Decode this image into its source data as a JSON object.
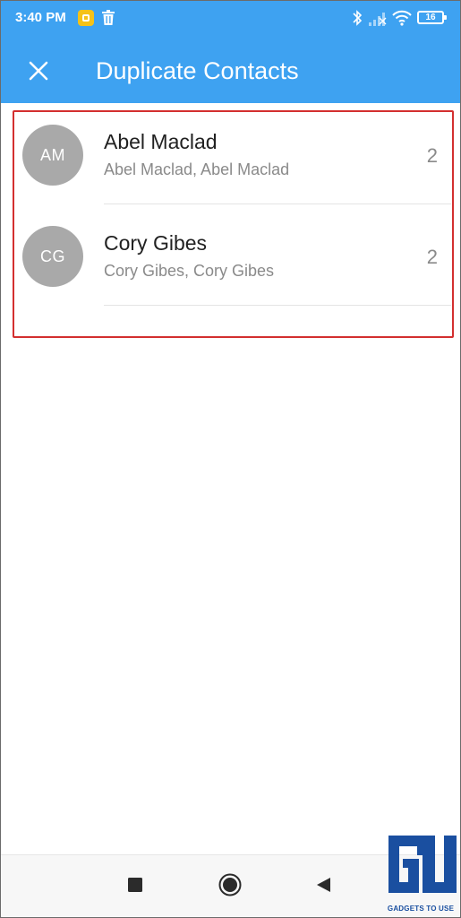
{
  "colors": {
    "accent": "#3ea2f1",
    "avatar": "#a9a9a9",
    "highlight": "#d32f2f",
    "watermark": "#1a4fa0"
  },
  "status_bar": {
    "time": "3:40 PM",
    "battery": "16",
    "icons": [
      "notification-icon",
      "trash-icon",
      "bluetooth-icon",
      "signal-icon",
      "wifi-icon",
      "battery-icon"
    ]
  },
  "app_bar": {
    "title": "Duplicate Contacts",
    "close_icon": "close-icon"
  },
  "contacts": [
    {
      "initials": "AM",
      "name": "Abel Maclad",
      "duplicates": "Abel Maclad, Abel Maclad",
      "count": "2"
    },
    {
      "initials": "CG",
      "name": "Cory Gibes",
      "duplicates": "Cory Gibes, Cory Gibes",
      "count": "2"
    }
  ],
  "nav_bar": {
    "buttons": [
      "recents-square-icon",
      "home-circle-icon",
      "back-triangle-icon"
    ]
  },
  "watermark": {
    "text": "GADGETS TO USE"
  }
}
